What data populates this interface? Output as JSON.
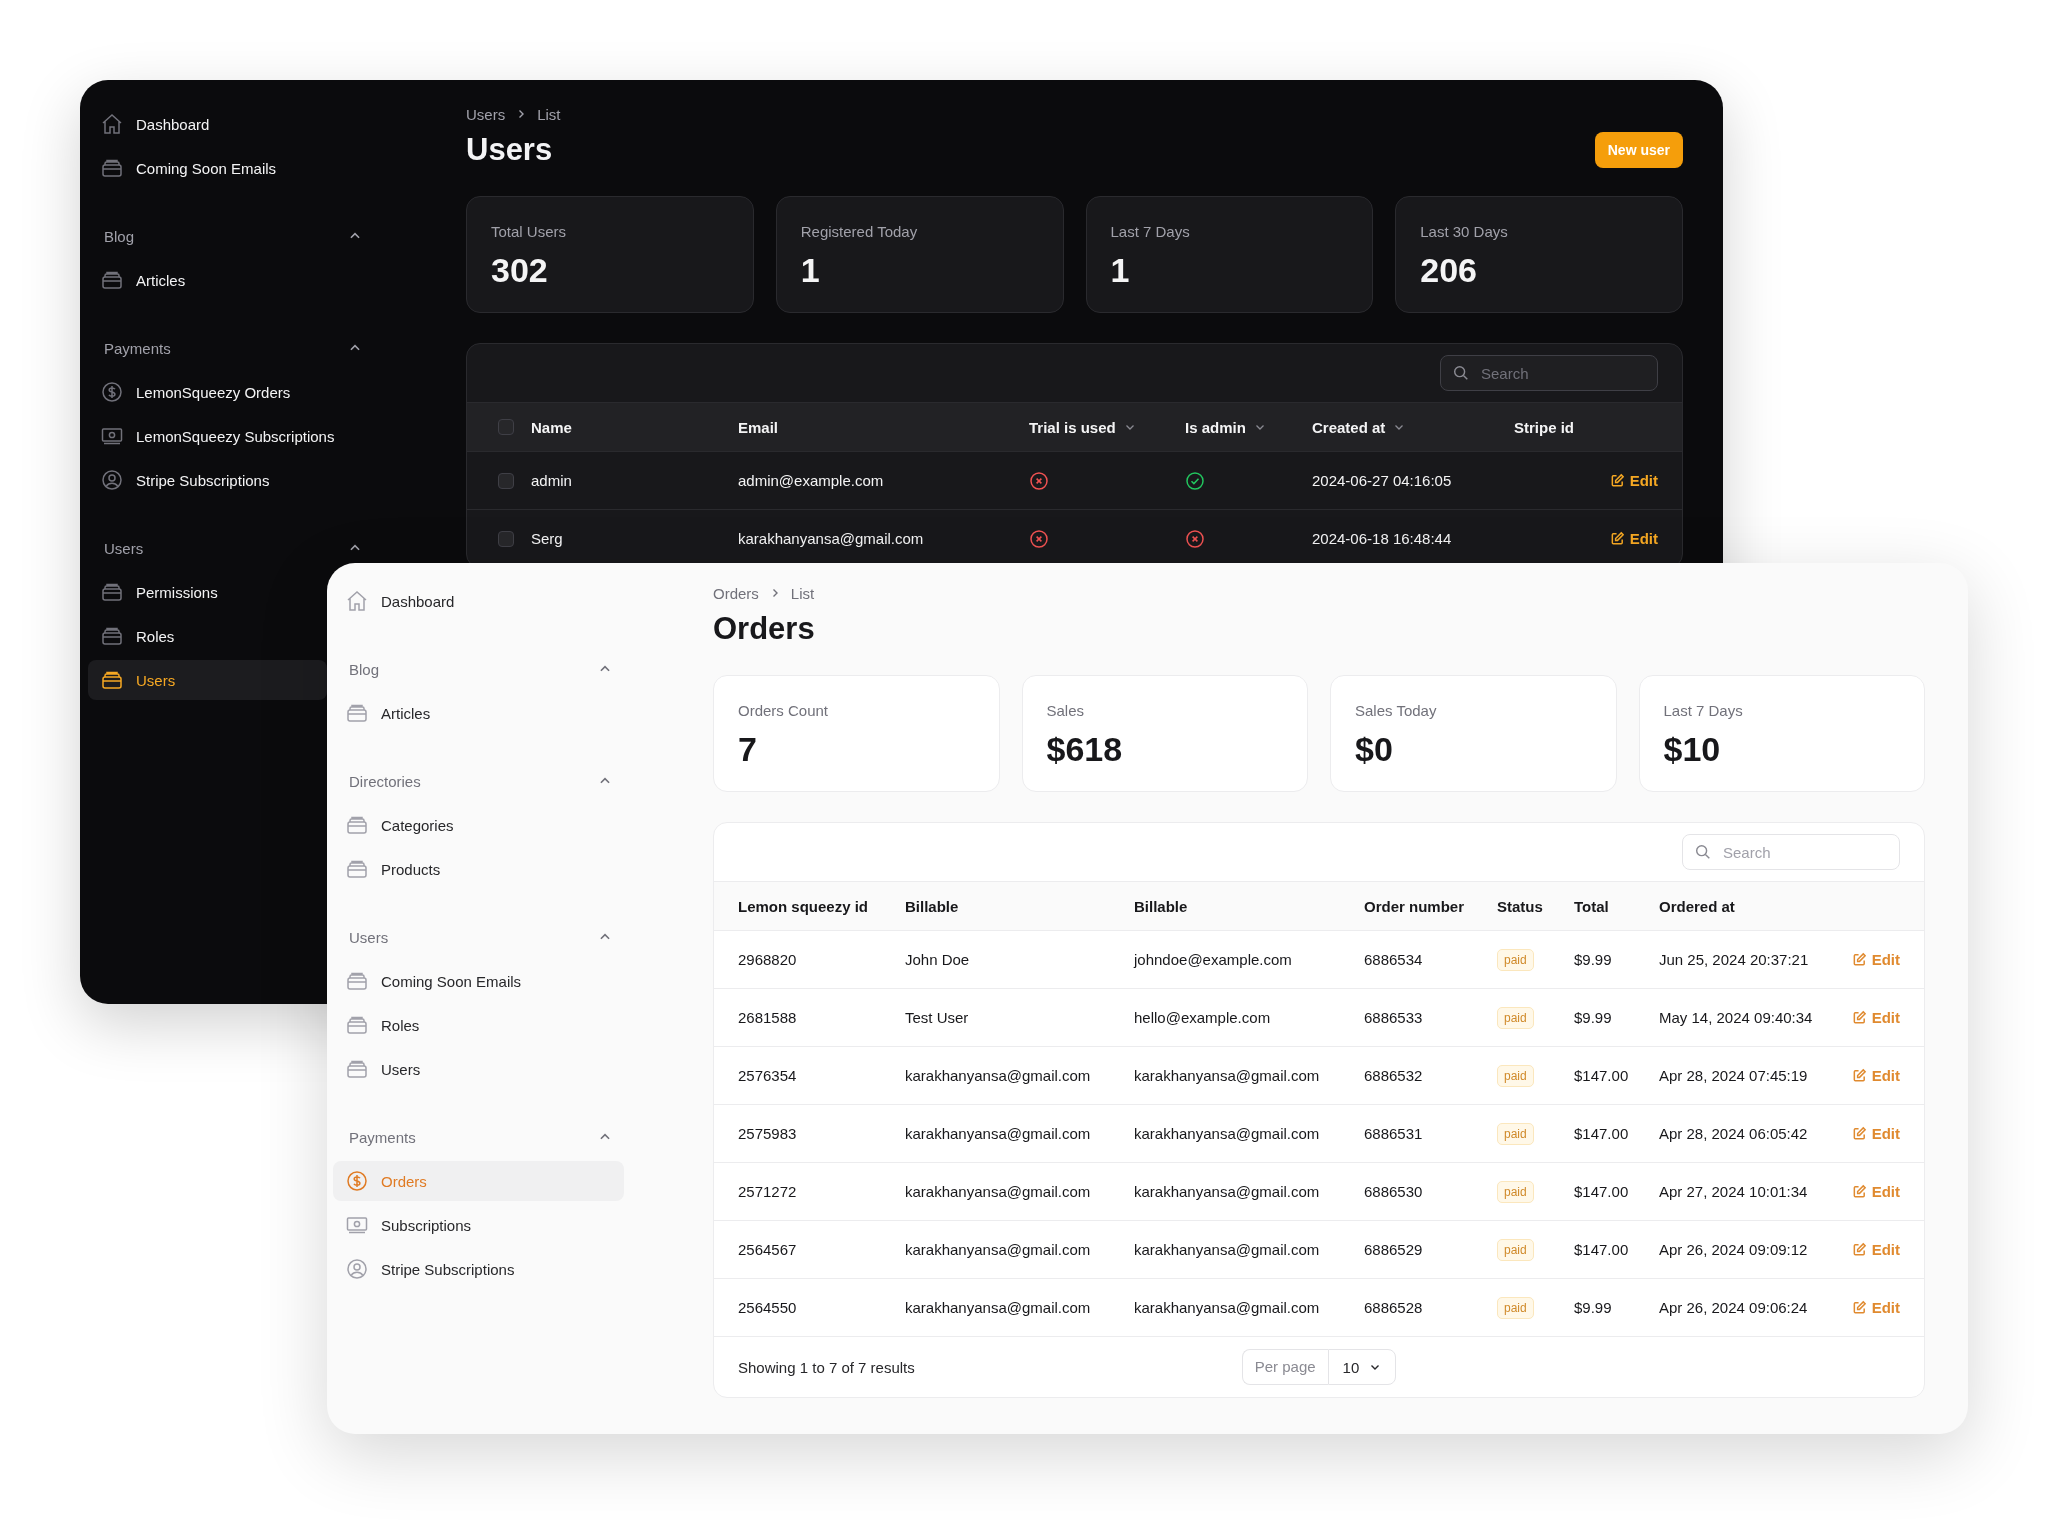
{
  "users_window": {
    "sidebar": [
      {
        "items": [
          {
            "label": "Dashboard",
            "kind": "home",
            "selected": false
          },
          {
            "label": "Coming Soon Emails",
            "kind": "stack",
            "selected": false
          }
        ]
      },
      {
        "label": "Blog",
        "expanded": true,
        "items": [
          {
            "label": "Articles",
            "kind": "stack",
            "selected": false
          }
        ]
      },
      {
        "label": "Payments",
        "expanded": true,
        "items": [
          {
            "label": "LemonSqueezy Orders",
            "kind": "dollar",
            "selected": false
          },
          {
            "label": "LemonSqueezy Subscriptions",
            "kind": "cash",
            "selected": false
          },
          {
            "label": "Stripe Subscriptions",
            "kind": "user",
            "selected": false
          }
        ]
      },
      {
        "label": "Users",
        "expanded": true,
        "items": [
          {
            "label": "Permissions",
            "kind": "stack",
            "selected": false
          },
          {
            "label": "Roles",
            "kind": "stack",
            "selected": false
          },
          {
            "label": "Users",
            "kind": "stack",
            "selected": true
          }
        ]
      }
    ],
    "breadcrumb": [
      "Users",
      "List"
    ],
    "title": "Users",
    "action_button": "New user",
    "stats": [
      {
        "label": "Total Users",
        "value": "302"
      },
      {
        "label": "Registered Today",
        "value": "1"
      },
      {
        "label": "Last 7 Days",
        "value": "1"
      },
      {
        "label": "Last 30 Days",
        "value": "206"
      }
    ],
    "table": {
      "search": {
        "placeholder": "Search"
      },
      "select_all_checked": false,
      "columns": [
        {
          "label": "Name",
          "sortable": false
        },
        {
          "label": "Email",
          "sortable": false
        },
        {
          "label": "Trial is used",
          "sortable": true
        },
        {
          "label": "Is admin",
          "sortable": true
        },
        {
          "label": "Created at",
          "sortable": true
        },
        {
          "label": "Stripe id",
          "sortable": false
        }
      ],
      "rows": [
        {
          "checked": false,
          "name": "admin",
          "email": "admin@example.com",
          "trial_used": false,
          "is_admin": true,
          "created_at": "2024-06-27 04:16:05",
          "action": "Edit"
        },
        {
          "checked": false,
          "name": "Serg",
          "email": "karakhanyansa@gmail.com",
          "trial_used": false,
          "is_admin": false,
          "created_at": "2024-06-18 16:48:44",
          "action": "Edit"
        }
      ]
    }
  },
  "orders_window": {
    "sidebar": [
      {
        "items": [
          {
            "label": "Dashboard",
            "kind": "home",
            "selected": false
          }
        ]
      },
      {
        "label": "Blog",
        "expanded": true,
        "items": [
          {
            "label": "Articles",
            "kind": "stack",
            "selected": false
          }
        ]
      },
      {
        "label": "Directories",
        "expanded": true,
        "items": [
          {
            "label": "Categories",
            "kind": "stack",
            "selected": false
          },
          {
            "label": "Products",
            "kind": "stack",
            "selected": false
          }
        ]
      },
      {
        "label": "Users",
        "expanded": true,
        "items": [
          {
            "label": "Coming Soon Emails",
            "kind": "stack",
            "selected": false
          },
          {
            "label": "Roles",
            "kind": "stack",
            "selected": false
          },
          {
            "label": "Users",
            "kind": "stack",
            "selected": false
          }
        ]
      },
      {
        "label": "Payments",
        "expanded": true,
        "items": [
          {
            "label": "Orders",
            "kind": "dollar",
            "selected": true
          },
          {
            "label": "Subscriptions",
            "kind": "cash",
            "selected": false
          },
          {
            "label": "Stripe Subscriptions",
            "kind": "user",
            "selected": false
          }
        ]
      }
    ],
    "breadcrumb": [
      "Orders",
      "List"
    ],
    "title": "Orders",
    "stats": [
      {
        "label": "Orders Count",
        "value": "7"
      },
      {
        "label": "Sales",
        "value": "$618"
      },
      {
        "label": "Sales Today",
        "value": "$0"
      },
      {
        "label": "Last 7 Days",
        "value": "$10"
      }
    ],
    "table": {
      "search": {
        "placeholder": "Search"
      },
      "columns": [
        "Lemon squeezy id",
        "Billable",
        "Billable",
        "Order number",
        "Status",
        "Total",
        "Ordered at"
      ],
      "rows": [
        {
          "id": "2968820",
          "billable_name": "John Doe",
          "billable_email": "johndoe@example.com",
          "order_number": "6886534",
          "status": "paid",
          "total": "$9.99",
          "ordered_at": "Jun 25, 2024 20:37:21",
          "action": "Edit"
        },
        {
          "id": "2681588",
          "billable_name": "Test User",
          "billable_email": "hello@example.com",
          "order_number": "6886533",
          "status": "paid",
          "total": "$9.99",
          "ordered_at": "May 14, 2024 09:40:34",
          "action": "Edit"
        },
        {
          "id": "2576354",
          "billable_name": "karakhanyansa@gmail.com",
          "billable_email": "karakhanyansa@gmail.com",
          "order_number": "6886532",
          "status": "paid",
          "total": "$147.00",
          "ordered_at": "Apr 28, 2024 07:45:19",
          "action": "Edit"
        },
        {
          "id": "2575983",
          "billable_name": "karakhanyansa@gmail.com",
          "billable_email": "karakhanyansa@gmail.com",
          "order_number": "6886531",
          "status": "paid",
          "total": "$147.00",
          "ordered_at": "Apr 28, 2024 06:05:42",
          "action": "Edit"
        },
        {
          "id": "2571272",
          "billable_name": "karakhanyansa@gmail.com",
          "billable_email": "karakhanyansa@gmail.com",
          "order_number": "6886530",
          "status": "paid",
          "total": "$147.00",
          "ordered_at": "Apr 27, 2024 10:01:34",
          "action": "Edit"
        },
        {
          "id": "2564567",
          "billable_name": "karakhanyansa@gmail.com",
          "billable_email": "karakhanyansa@gmail.com",
          "order_number": "6886529",
          "status": "paid",
          "total": "$147.00",
          "ordered_at": "Apr 26, 2024 09:09:12",
          "action": "Edit"
        },
        {
          "id": "2564550",
          "billable_name": "karakhanyansa@gmail.com",
          "billable_email": "karakhanyansa@gmail.com",
          "order_number": "6886528",
          "status": "paid",
          "total": "$9.99",
          "ordered_at": "Apr 26, 2024 09:06:24",
          "action": "Edit"
        }
      ],
      "footer": {
        "summary": "Showing 1 to 7 of 7 results",
        "per_page_label": "Per page",
        "per_page_value": "10"
      }
    }
  }
}
